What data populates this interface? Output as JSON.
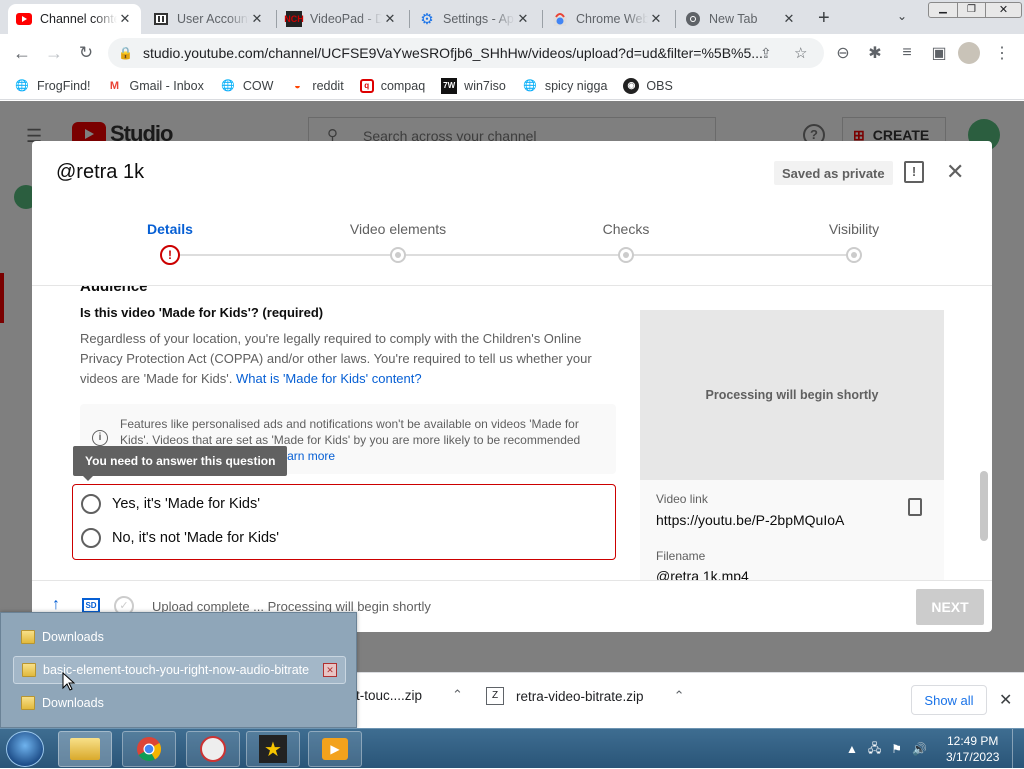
{
  "tabs": [
    {
      "title": "Channel content",
      "icon": "youtube-icon",
      "active": true
    },
    {
      "title": "User Accounts",
      "icon": "user-accounts-icon"
    },
    {
      "title": "VideoPad - Download",
      "icon": "nch-icon"
    },
    {
      "title": "Settings - Appearance",
      "icon": "settings-gear-icon"
    },
    {
      "title": "Chrome Web Store",
      "icon": "chrome-web-store-icon"
    },
    {
      "title": "New Tab",
      "icon": "chrome-icon"
    }
  ],
  "address_bar": {
    "url": "studio.youtube.com/channel/UCFSE9VaYweSROfjb6_SHhHw/videos/upload?d=ud&filter=%5B%5..."
  },
  "bookmarks": [
    {
      "label": "FrogFind!",
      "icon": "globe-icon"
    },
    {
      "label": "Gmail - Inbox",
      "icon": "gmail-icon"
    },
    {
      "label": "COW",
      "icon": "globe-icon"
    },
    {
      "label": "reddit",
      "icon": "reddit-icon"
    },
    {
      "label": "compaq",
      "icon": "compaq-icon"
    },
    {
      "label": "win7iso",
      "icon": "win7iso-icon"
    },
    {
      "label": "spicy nigga",
      "icon": "globe-icon"
    },
    {
      "label": "OBS",
      "icon": "github-icon"
    }
  ],
  "studio_bg": {
    "search_placeholder": "Search across your channel",
    "create_label": "CREATE",
    "logo_text": "Studio"
  },
  "dialog": {
    "title": "@retra 1k",
    "saved_badge": "Saved as private",
    "steps": [
      "Details",
      "Video elements",
      "Checks",
      "Visibility"
    ],
    "section_heading": "Audience",
    "question": "Is this video 'Made for Kids'? (required)",
    "paragraph": "Regardless of your location, you're legally required to comply with the Children's Online Privacy Protection Act (COPPA) and/or other laws. You're required to tell us whether your videos are 'Made for Kids'.",
    "paragraph_link": "What is 'Made for Kids' content?",
    "info_text": "Features like personalised ads and notifications won't be available on videos 'Made for Kids'. Videos that are set as 'Made for Kids' by you are more likely to be recommended alongside other kids' videos.",
    "info_link": "Learn more",
    "tooltip": "You need to answer this question",
    "radio_yes": "Yes, it's 'Made for Kids'",
    "radio_no": "No, it's not 'Made for Kids'",
    "preview_text": "Processing will begin shortly",
    "video_link_label": "Video link",
    "video_link": "https://youtu.be/P-2bpMQuIoA",
    "filename_label": "Filename",
    "filename": "@retra 1k.mp4",
    "footer_status": "Upload complete ... Processing will begin shortly",
    "sd_badge": "SD",
    "next_label": "NEXT"
  },
  "jumplist": {
    "items": [
      "Downloads",
      "basic-element-touch-you-right-now-audio-bitrate",
      "Downloads"
    ]
  },
  "downloads": {
    "items": [
      {
        "name": "t-touc....zip"
      },
      {
        "name": "retra-video-bitrate.zip"
      }
    ],
    "show_all": "Show all"
  },
  "taskbar": {
    "time": "12:49 PM",
    "date": "3/17/2023"
  }
}
